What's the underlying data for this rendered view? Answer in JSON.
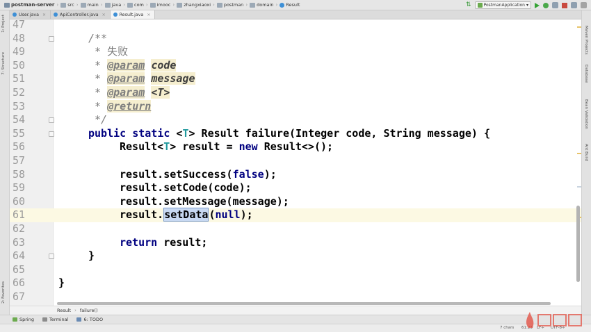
{
  "navbar": {
    "breadcrumbs": [
      "postman-server",
      "src",
      "main",
      "java",
      "com",
      "imooc",
      "zhangxiaoxi",
      "postman",
      "domain",
      "Result"
    ],
    "run_config": "PostmanApplication"
  },
  "tabs": [
    {
      "label": "User.java",
      "active": false
    },
    {
      "label": "ApiController.java",
      "active": false
    },
    {
      "label": "Result.java",
      "active": true
    }
  ],
  "left_tool_windows": [
    "1: Project",
    "7: Structure",
    "2: Favorites"
  ],
  "right_tool_windows": [
    "Maven Projects",
    "Database",
    "Bean Validation",
    "Ant Build"
  ],
  "editor": {
    "current_line": "61",
    "lines": [
      {
        "num": "47",
        "text": ""
      },
      {
        "num": "48",
        "text": "/**"
      },
      {
        "num": "49",
        "prefix": " * ",
        "text": "失败"
      },
      {
        "num": "50",
        "prefix": " * ",
        "tag": "@param",
        "param": "code"
      },
      {
        "num": "51",
        "prefix": " * ",
        "tag": "@param",
        "param": "message"
      },
      {
        "num": "52",
        "prefix": " * ",
        "tag": "@param",
        "param": "<T>"
      },
      {
        "num": "53",
        "prefix": " * ",
        "tag": "@return"
      },
      {
        "num": "54",
        "text": " */"
      },
      {
        "num": "55",
        "kw1": "public",
        "kw2": "static",
        "lt": " <",
        "tp": "T",
        "rest": "> Result failure(Integer code, String message) {"
      },
      {
        "num": "56",
        "a": "Result<",
        "tp": "T",
        "b": "> result = ",
        "kw": "new",
        "c": " Result<>();"
      },
      {
        "num": "57",
        "text": ""
      },
      {
        "num": "58",
        "a": "result.setSuccess(",
        "kw": "false",
        "c": ");"
      },
      {
        "num": "59",
        "text": "result.setCode(code);"
      },
      {
        "num": "60",
        "text": "result.setMessage(message);"
      },
      {
        "num": "61",
        "a": "result.",
        "sel": "setData",
        "b": "(",
        "kw": "null",
        "c": ");"
      },
      {
        "num": "62",
        "text": ""
      },
      {
        "num": "63",
        "kw": "return",
        "c": " result;"
      },
      {
        "num": "64",
        "text": "}"
      },
      {
        "num": "65",
        "text": ""
      },
      {
        "num": "66",
        "text": "}"
      },
      {
        "num": "67",
        "text": ""
      }
    ]
  },
  "editor_breadcrumbs": [
    "Result",
    "failure()"
  ],
  "bottom_tools": [
    {
      "label": "Spring",
      "icon": "spring-icon"
    },
    {
      "label": "Terminal",
      "icon": "terminal-icon"
    },
    {
      "label": "6: TODO",
      "icon": "todo-icon"
    }
  ],
  "status": {
    "chars": "7 chars",
    "position": "61:23",
    "line_sep": "LF÷",
    "encoding": "UTF-8÷"
  },
  "colors": {
    "keyword": "#000080",
    "type_param": "#20999d",
    "comment": "#7d7d7d",
    "selection": "#c8d9f2",
    "current_line": "#fcf9e3"
  }
}
